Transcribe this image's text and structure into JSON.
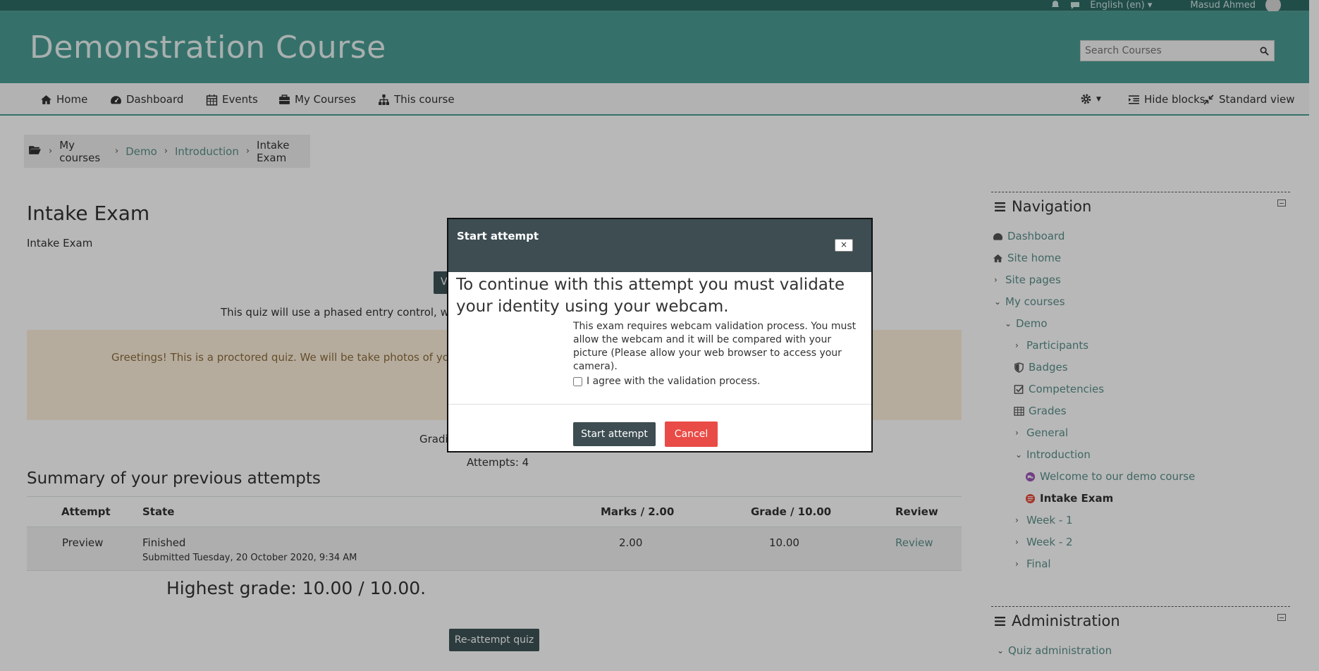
{
  "topbar": {
    "language": "English (en) ▾",
    "user_name": "Masud Ahmed"
  },
  "banner": {
    "title": "Demonstration Course",
    "search_placeholder": "Search Courses"
  },
  "navbar": {
    "items": [
      {
        "label": "Home",
        "icon": "home-icon"
      },
      {
        "label": "Dashboard",
        "icon": "dashboard-icon"
      },
      {
        "label": "Events",
        "icon": "calendar-icon"
      },
      {
        "label": "My Courses",
        "icon": "briefcase-icon"
      },
      {
        "label": "This course",
        "icon": "sitemap-icon"
      }
    ],
    "hide_blocks": "Hide blocks",
    "standard_view": "Standard view"
  },
  "breadcrumb": {
    "items": [
      "My courses",
      "Demo",
      "Introduction",
      "Intake Exam"
    ]
  },
  "main": {
    "title": "Intake Exam",
    "subtitle": "Intake Exam",
    "partial_button": "V",
    "info_line": "This quiz will use a phased entry control, which w",
    "alert": "Greetings! This is a proctored quiz. We will be take photos of you while",
    "grading": "Gradin",
    "attempts": "Attempts: 4",
    "summary_title": "Summary of your previous attempts",
    "table": {
      "headers": [
        "Attempt",
        "State",
        "Marks / 2.00",
        "Grade / 10.00",
        "Review"
      ],
      "row": {
        "attempt": "Preview",
        "state": "Finished",
        "submitted": "Submitted Tuesday, 20 October 2020, 9:34 AM",
        "marks": "2.00",
        "grade": "10.00",
        "review": "Review"
      }
    },
    "highest": "Highest grade: 10.00 / 10.00.",
    "reattempt": "Re-attempt quiz"
  },
  "navigation_block": {
    "title": "Navigation",
    "items": {
      "dashboard": "Dashboard",
      "site_home": "Site home",
      "site_pages": "Site pages",
      "my_courses": "My courses",
      "demo": "Demo",
      "participants": "Participants",
      "badges": "Badges",
      "competencies": "Competencies",
      "grades": "Grades",
      "general": "General",
      "introduction": "Introduction",
      "welcome": "Welcome to our demo course",
      "intake_exam": "Intake Exam",
      "week1": "Week - 1",
      "week2": "Week - 2",
      "final": "Final"
    }
  },
  "administration_block": {
    "title": "Administration",
    "quiz_admin": "Quiz administration"
  },
  "modal": {
    "title": "Start attempt",
    "close": "×",
    "lead": "To continue with this attempt you must validate your identity using your webcam.",
    "description": "This exam requires webcam validation process. You must allow the webcam and it will be compared with your picture (Please allow your web browser to access your camera).",
    "agree_label": "I agree with the validation process.",
    "start_button": "Start attempt",
    "cancel_button": "Cancel"
  },
  "colors": {
    "brand": "#4a9d94",
    "link": "#5a8f89",
    "dark_button": "#3d4d52",
    "danger": "#e94b46"
  }
}
